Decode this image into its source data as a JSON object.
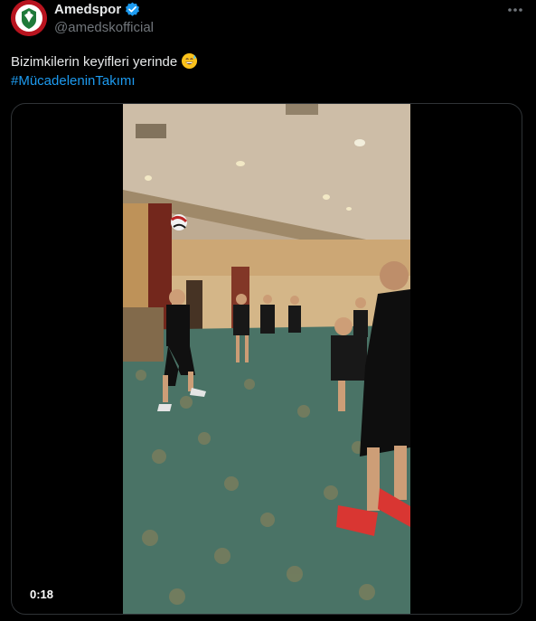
{
  "author": {
    "display_name": "Amedspor",
    "handle": "@amedskofficial",
    "verified": true,
    "avatar_icon": "amedspor-crest-icon"
  },
  "tweet": {
    "text": "Bizimkilerin keyifleri yerinde",
    "emoji": "sweat-smile-emoji",
    "hashtag": "#MücadeleninTakımı"
  },
  "media": {
    "type": "video",
    "duration": "0:18"
  },
  "colors": {
    "background": "#000000",
    "text": "#e7e9ea",
    "muted": "#71767b",
    "link": "#1d9bf0",
    "verified": "#1d9bf0",
    "border": "#2f3336"
  }
}
